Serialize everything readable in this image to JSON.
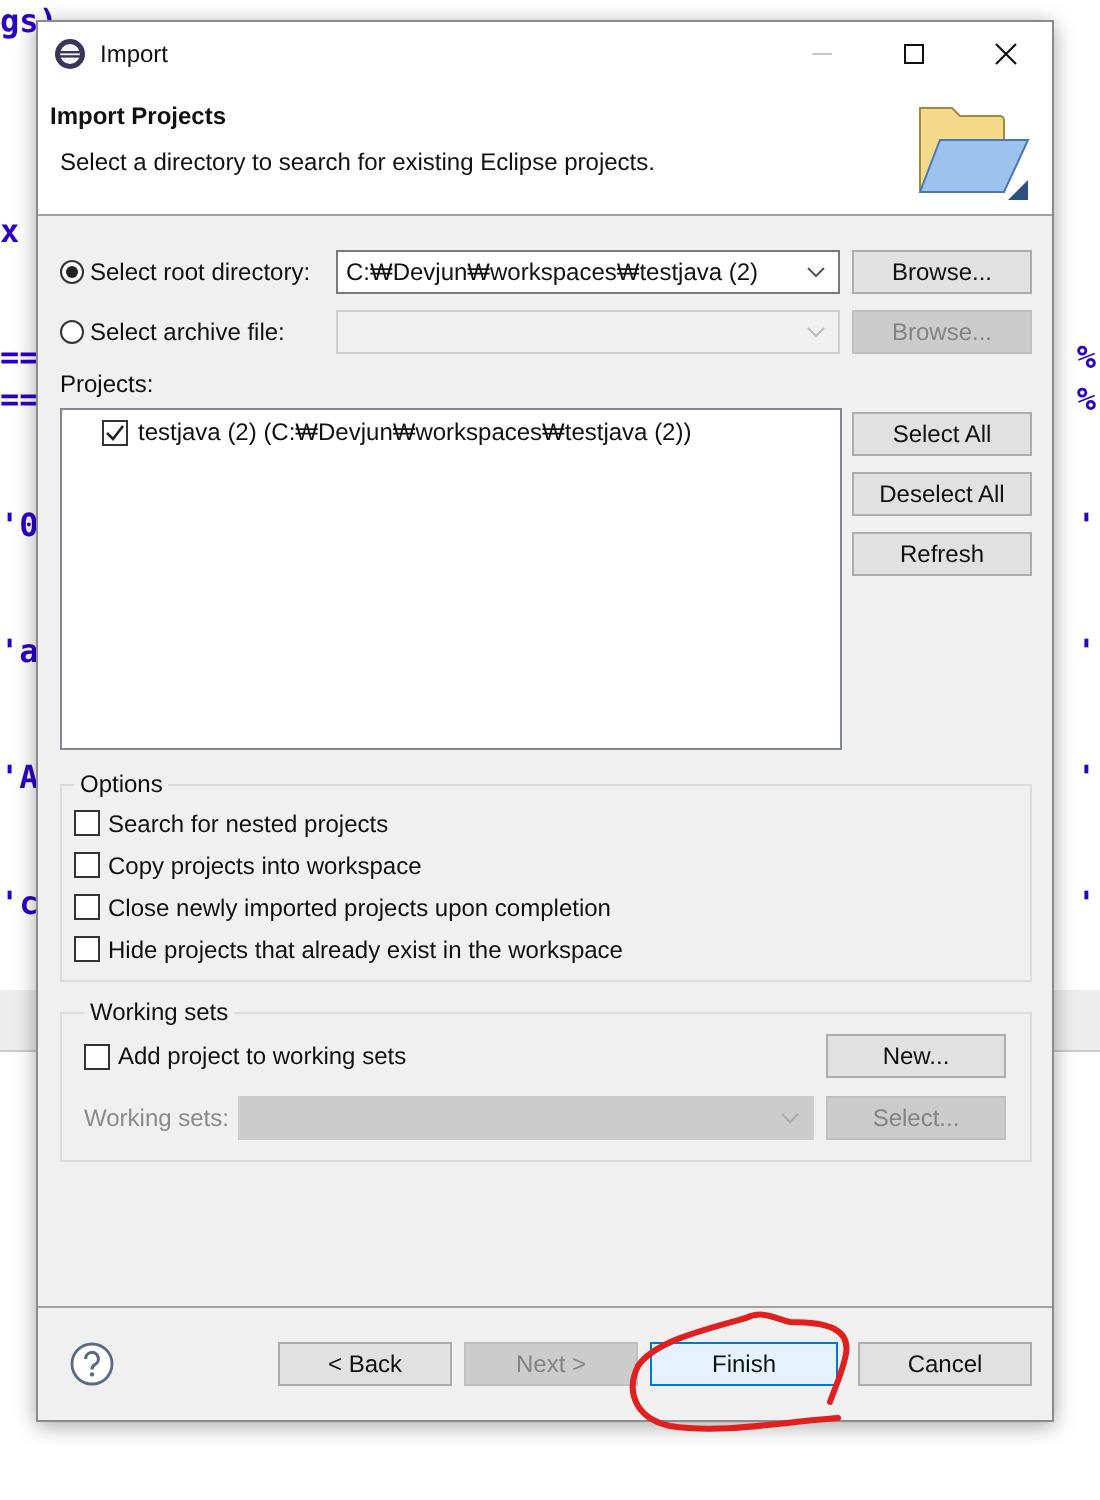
{
  "editor": {
    "lines": [
      {
        "kind": "code",
        "left": "gs)"
      },
      {
        "kind": "blank"
      },
      {
        "kind": "blank"
      },
      {
        "kind": "blank"
      },
      {
        "kind": "blank"
      },
      {
        "kind": "code",
        "left": "x"
      },
      {
        "kind": "blank"
      },
      {
        "kind": "blank"
      },
      {
        "kind": "code",
        "left": "==",
        "right": "%"
      },
      {
        "kind": "code",
        "left": "==",
        "right": "%"
      },
      {
        "kind": "blank"
      },
      {
        "kind": "blank"
      },
      {
        "kind": "code",
        "left": "'0",
        "right": "'"
      },
      {
        "kind": "blank"
      },
      {
        "kind": "blank"
      },
      {
        "kind": "code",
        "left": "'a",
        "right": "'"
      },
      {
        "kind": "blank"
      },
      {
        "kind": "blank"
      },
      {
        "kind": "code",
        "left": "'A",
        "right": "'"
      },
      {
        "kind": "blank"
      },
      {
        "kind": "blank"
      },
      {
        "kind": "code",
        "left": "'c",
        "right": "'"
      }
    ]
  },
  "dialog": {
    "title": "Import",
    "header": {
      "title": "Import Projects",
      "description": "Select a directory to search for existing Eclipse projects."
    },
    "sources": [
      {
        "label": "Select root directory:",
        "selected": true,
        "value": "C:₩Devjun₩workspaces₩testjava (2)",
        "browse": "Browse...",
        "disabled": false
      },
      {
        "label": "Select archive file:",
        "selected": false,
        "browse": "Browse...",
        "disabled": true
      }
    ],
    "projects": {
      "label": "Projects:",
      "items": [
        {
          "label": "testjava (2) (C:₩Devjun₩workspaces₩testjava (2))",
          "checked": true
        }
      ],
      "buttons": [
        "Select All",
        "Deselect All",
        "Refresh"
      ]
    },
    "options": {
      "title": "Options",
      "items": [
        {
          "label": "Search for nested projects",
          "checked": false
        },
        {
          "label": "Copy projects into workspace",
          "checked": false
        },
        {
          "label": "Close newly imported projects upon completion",
          "checked": false
        },
        {
          "label": "Hide projects that already exist in the workspace",
          "checked": false
        }
      ]
    },
    "working_sets": {
      "title": "Working sets",
      "add": {
        "label": "Add project to working sets",
        "checked": false
      },
      "new_button": "New...",
      "field_label": "Working sets:",
      "select_button": "Select...",
      "disabled": true
    },
    "footer": {
      "buttons": [
        {
          "label": "< Back",
          "disabled": false,
          "focused": false
        },
        {
          "label": "Next >",
          "disabled": true,
          "focused": false
        },
        {
          "label": "Finish",
          "disabled": false,
          "focused": true
        },
        {
          "label": "Cancel",
          "disabled": false,
          "focused": false
        }
      ]
    }
  }
}
